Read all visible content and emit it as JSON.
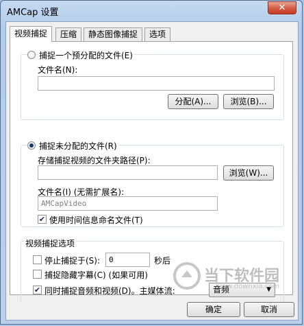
{
  "window": {
    "title": "AMCap 设置",
    "close_label": "✕"
  },
  "tabs": [
    "视频捕捉",
    "压缩",
    "静态图像捕捉",
    "选项"
  ],
  "preallocated": {
    "radio_label": "捕捉一个预分配的文件(E)",
    "filename_label": "文件名(N):",
    "filename_value": "",
    "allocate_button": "分配(A)...",
    "browse_button": "浏览(B)..."
  },
  "unallocated": {
    "radio_label": "捕捉未分配的文件(R)",
    "folder_label": "存储捕捉视频的文件夹路径(P):",
    "folder_value": "",
    "browse_button": "浏览(W)...",
    "filename_label": "文件名(I) (无需扩展名):",
    "filename_value": "AMCapVideo",
    "timestamp_checkbox": "使用时间信息命名文件(T)"
  },
  "options": {
    "group_label": "视频捕捉选项",
    "stop_capture_label": "停止捕捉于(S):",
    "stop_capture_value": "0",
    "stop_capture_unit": "秒后",
    "captions_label": "捕捉隐藏字幕(C) (如果可用)",
    "audio_video_label": "同时捕捉音频和视频(D)。主媒体流:",
    "master_stream_value": "音频"
  },
  "footer": {
    "ok_button": "确定",
    "cancel_button": "取消"
  },
  "watermark": {
    "text": "当下软件园",
    "url": "www.downxia.com"
  }
}
